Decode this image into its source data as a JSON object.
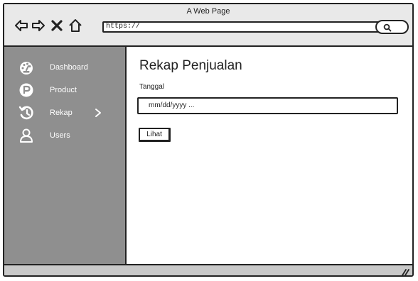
{
  "window": {
    "title": "A Web Page"
  },
  "toolbar": {
    "back_icon": "back-arrow-icon",
    "forward_icon": "forward-arrow-icon",
    "close_icon": "close-x-icon",
    "home_icon": "home-icon",
    "url": "https://",
    "search_icon": "search-icon"
  },
  "sidebar": {
    "items": [
      {
        "label": "Dashboard",
        "icon": "dashboard-gauge-icon"
      },
      {
        "label": "Product",
        "icon": "product-p-icon"
      },
      {
        "label": "Rekap",
        "icon": "history-icon",
        "has_submenu": true
      },
      {
        "label": "Users",
        "icon": "user-icon"
      }
    ]
  },
  "main": {
    "title": "Rekap Penjualan",
    "date_label": "Tanggal",
    "date_placeholder": "mm/dd/yyyy    ...",
    "submit_label": "Lihat"
  },
  "colors": {
    "sidebar_bg": "#8f8f8f",
    "topbar_bg": "#e9e9e9",
    "statusbar_bg": "#c9c9c9",
    "outline": "#222222"
  }
}
